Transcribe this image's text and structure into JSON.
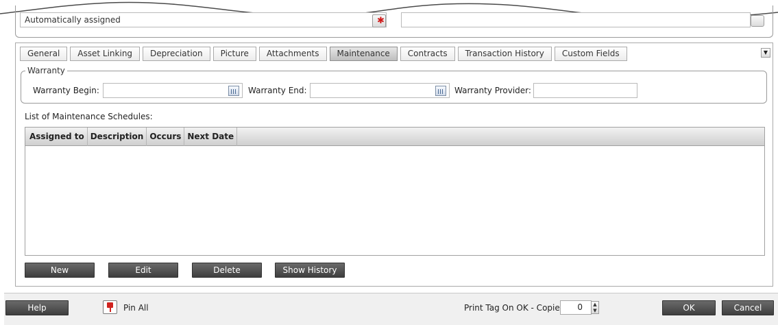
{
  "top": {
    "assigned_value": "Automatically assigned"
  },
  "tabs": [
    {
      "label": "General"
    },
    {
      "label": "Asset Linking"
    },
    {
      "label": "Depreciation"
    },
    {
      "label": "Picture"
    },
    {
      "label": "Attachments"
    },
    {
      "label": "Maintenance",
      "active": true
    },
    {
      "label": "Contracts"
    },
    {
      "label": "Transaction History"
    },
    {
      "label": "Custom Fields"
    }
  ],
  "warranty": {
    "legend": "Warranty",
    "begin_label": "Warranty Begin:",
    "begin_value": "",
    "end_label": "Warranty End:",
    "end_value": "",
    "provider_label": "Warranty Provider:",
    "provider_value": ""
  },
  "schedules": {
    "label": "List of Maintenance Schedules:",
    "columns": [
      "Assigned to",
      "Description",
      "Occurs",
      "Next Date"
    ],
    "rows": []
  },
  "actions": {
    "new": "New",
    "edit": "Edit",
    "delete": "Delete",
    "show_history": "Show History"
  },
  "footer": {
    "help": "Help",
    "pin_all": "Pin All",
    "print_tag_label": "Print Tag On OK - Copies:",
    "copies_value": "0",
    "ok": "OK",
    "cancel": "Cancel"
  },
  "icons": {
    "tab_menu": "dropdown-arrow-icon",
    "calendar": "calendar-icon",
    "pin": "pushpin-icon",
    "clear": "clear-red-x-icon"
  }
}
